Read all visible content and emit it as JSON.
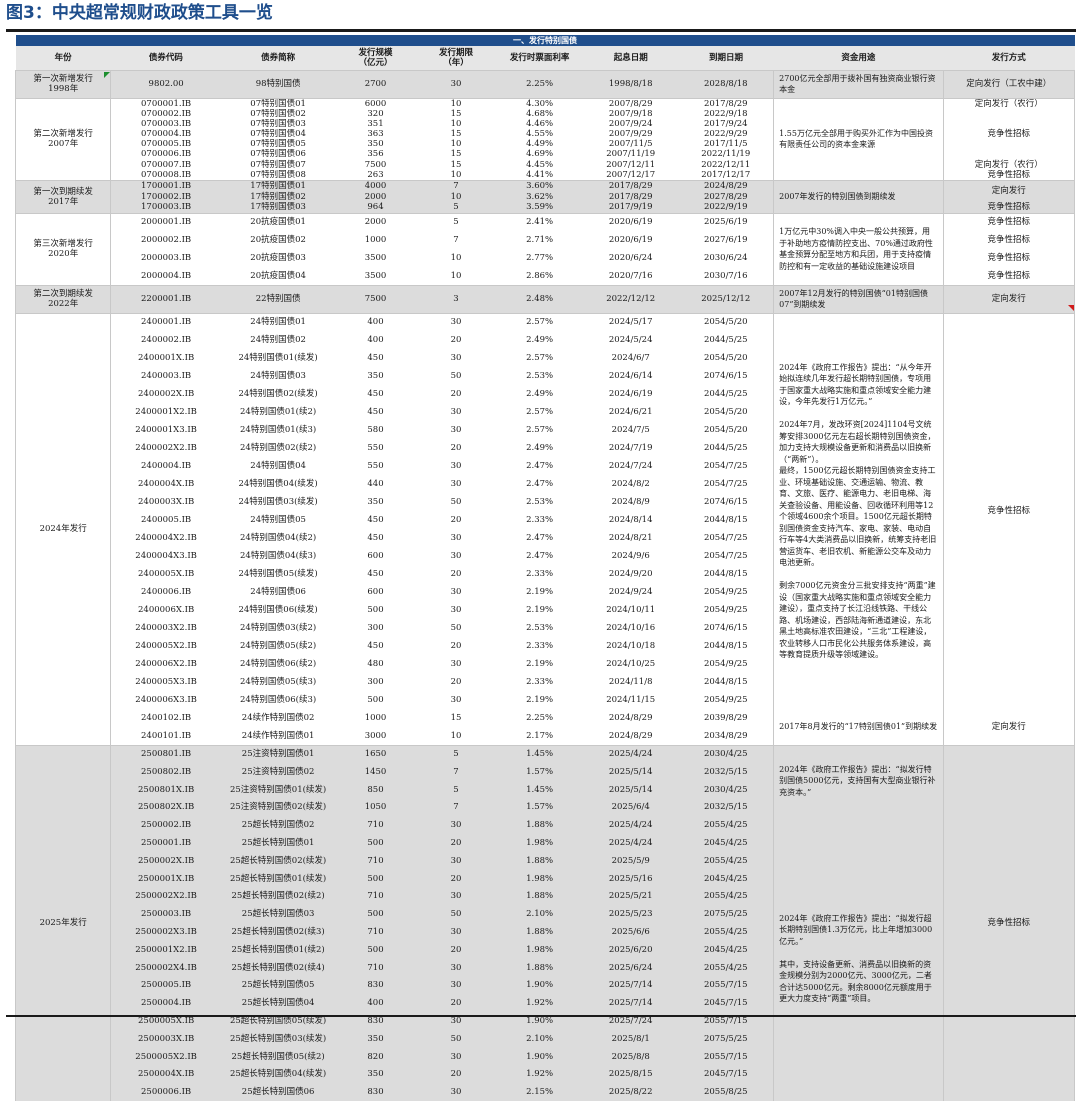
{
  "figure_title": "图3：中央超常规财政政策工具一览",
  "section_title": "一、发行特别国债",
  "headers": {
    "year": "年份",
    "code": "债券代码",
    "name": "债券简称",
    "scale": "发行规模\n（亿元）",
    "term": "发行期限\n（年）",
    "rate": "发行时票面利率",
    "start": "起息日期",
    "due": "到期日期",
    "use": "资金用途",
    "method": "发行方式"
  },
  "groups": [
    {
      "year": "第一次新增发行\n1998年",
      "gray": true,
      "rows": [
        [
          "9802.00",
          "98特别国债",
          "2700",
          "30",
          "2.25%",
          "1998/8/18",
          "2028/8/18"
        ]
      ],
      "uses": [
        {
          "rows": 1,
          "text": "2700亿元全部用于拨补国有独资商业银行资本金"
        }
      ],
      "methods": [
        {
          "rows": 1,
          "text": "定向发行（工农中建）"
        }
      ]
    },
    {
      "year": "第二次新增发行\n2007年",
      "gray": false,
      "rows": [
        [
          "0700001.IB",
          "07特别国债01",
          "6000",
          "10",
          "4.30%",
          "2007/8/29",
          "2017/8/29"
        ],
        [
          "0700002.IB",
          "07特别国债02",
          "320",
          "15",
          "4.68%",
          "2007/9/18",
          "2022/9/18"
        ],
        [
          "0700003.IB",
          "07特别国债03",
          "351",
          "10",
          "4.46%",
          "2007/9/24",
          "2017/9/24"
        ],
        [
          "0700004.IB",
          "07特别国债04",
          "363",
          "15",
          "4.55%",
          "2007/9/29",
          "2022/9/29"
        ],
        [
          "0700005.IB",
          "07特别国债05",
          "350",
          "10",
          "4.49%",
          "2007/11/5",
          "2017/11/5"
        ],
        [
          "0700006.IB",
          "07特别国债06",
          "356",
          "15",
          "4.69%",
          "2007/11/19",
          "2022/11/19"
        ],
        [
          "0700007.IB",
          "07特别国债07",
          "7500",
          "15",
          "4.45%",
          "2007/12/11",
          "2022/12/11"
        ],
        [
          "0700008.IB",
          "07特别国债08",
          "263",
          "10",
          "4.41%",
          "2007/12/17",
          "2017/12/17"
        ]
      ],
      "uses": [
        {
          "rows": 8,
          "text": "1.55万亿元全部用于购买外汇作为中国投资有限责任公司的资本金来源"
        }
      ],
      "methods": [
        {
          "rows": 1,
          "text": "定向发行（农行）"
        },
        {
          "rows": 5,
          "text": "竞争性招标"
        },
        {
          "rows": 1,
          "text": "定向发行（农行）"
        },
        {
          "rows": 1,
          "text": "竞争性招标"
        }
      ]
    },
    {
      "year": "第一次到期续发\n2017年",
      "gray": true,
      "rows": [
        [
          "1700001.IB",
          "17特别国债01",
          "4000",
          "7",
          "3.60%",
          "2017/8/29",
          "2024/8/29"
        ],
        [
          "1700002.IB",
          "17特别国债02",
          "2000",
          "10",
          "3.62%",
          "2017/8/29",
          "2027/8/29"
        ],
        [
          "1700003.IB",
          "17特别国债03",
          "964",
          "5",
          "3.59%",
          "2017/9/19",
          "2022/9/19"
        ]
      ],
      "uses": [
        {
          "rows": 3,
          "text": "2007年发行的特别国债到期续发"
        }
      ],
      "methods": [
        {
          "rows": 2,
          "text": "定向发行"
        },
        {
          "rows": 1,
          "text": "竞争性招标"
        }
      ]
    },
    {
      "year": "第三次新增发行\n2020年",
      "gray": false,
      "rows": [
        [
          "2000001.IB",
          "20抗疫国债01",
          "2000",
          "5",
          "2.41%",
          "2020/6/19",
          "2025/6/19"
        ],
        [
          "2000002.IB",
          "20抗疫国债02",
          "1000",
          "7",
          "2.71%",
          "2020/6/19",
          "2027/6/19"
        ],
        [
          "2000003.IB",
          "20抗疫国债03",
          "3500",
          "10",
          "2.77%",
          "2020/6/24",
          "2030/6/24"
        ],
        [
          "2000004.IB",
          "20抗疫国债04",
          "3500",
          "10",
          "2.86%",
          "2020/7/16",
          "2030/7/16"
        ]
      ],
      "uses": [
        {
          "rows": 4,
          "text": "1万亿元中30%调入中央一般公共预算，用于补助地方疫情防控支出、70%通过政府性基金预算分配至地方和兵团，用于支持疫情防控和有一定收益的基础设施建设项目"
        }
      ],
      "methods": [
        {
          "rows": 1,
          "text": "竞争性招标"
        },
        {
          "rows": 1,
          "text": "竞争性招标"
        },
        {
          "rows": 1,
          "text": "竞争性招标"
        },
        {
          "rows": 1,
          "text": "竞争性招标"
        }
      ]
    },
    {
      "year": "第二次到期续发\n2022年",
      "gray": true,
      "rows": [
        [
          "2200001.IB",
          "22特别国债",
          "7500",
          "3",
          "2.48%",
          "2022/12/12",
          "2025/12/12"
        ]
      ],
      "uses": [
        {
          "rows": 1,
          "text": "2007年12月发行的特别国债“01特别国债07”到期续发"
        }
      ],
      "methods": [
        {
          "rows": 1,
          "text": "定向发行"
        }
      ]
    },
    {
      "year": "2024年发行",
      "gray": false,
      "rows": [
        [
          "2400001.IB",
          "24特别国债01",
          "400",
          "30",
          "2.57%",
          "2024/5/17",
          "2054/5/20"
        ],
        [
          "2400002.IB",
          "24特别国债02",
          "400",
          "20",
          "2.49%",
          "2024/5/24",
          "2044/5/25"
        ],
        [
          "2400001X.IB",
          "24特别国债01(续发)",
          "450",
          "30",
          "2.57%",
          "2024/6/7",
          "2054/5/20"
        ],
        [
          "2400003.IB",
          "24特别国债03",
          "350",
          "50",
          "2.53%",
          "2024/6/14",
          "2074/6/15"
        ],
        [
          "2400002X.IB",
          "24特别国债02(续发)",
          "450",
          "20",
          "2.49%",
          "2024/6/19",
          "2044/5/25"
        ],
        [
          "2400001X2.IB",
          "24特别国债01(续2)",
          "450",
          "30",
          "2.57%",
          "2024/6/21",
          "2054/5/20"
        ],
        [
          "2400001X3.IB",
          "24特别国债01(续3)",
          "580",
          "30",
          "2.57%",
          "2024/7/5",
          "2054/5/20"
        ],
        [
          "2400002X2.IB",
          "24特别国债02(续2)",
          "550",
          "20",
          "2.49%",
          "2024/7/19",
          "2044/5/25"
        ],
        [
          "2400004.IB",
          "24特别国债04",
          "550",
          "30",
          "2.47%",
          "2024/7/24",
          "2054/7/25"
        ],
        [
          "2400004X.IB",
          "24特别国债04(续发)",
          "440",
          "30",
          "2.47%",
          "2024/8/2",
          "2054/7/25"
        ],
        [
          "2400003X.IB",
          "24特别国债03(续发)",
          "350",
          "50",
          "2.53%",
          "2024/8/9",
          "2074/6/15"
        ],
        [
          "2400005.IB",
          "24特别国债05",
          "450",
          "20",
          "2.33%",
          "2024/8/14",
          "2044/8/15"
        ],
        [
          "2400004X2.IB",
          "24特别国债04(续2)",
          "450",
          "30",
          "2.47%",
          "2024/8/21",
          "2054/7/25"
        ],
        [
          "2400004X3.IB",
          "24特别国债04(续3)",
          "600",
          "30",
          "2.47%",
          "2024/9/6",
          "2054/7/25"
        ],
        [
          "2400005X.IB",
          "24特别国债05(续发)",
          "450",
          "20",
          "2.33%",
          "2024/9/20",
          "2044/8/15"
        ],
        [
          "2400006.IB",
          "24特别国债06",
          "600",
          "30",
          "2.19%",
          "2024/9/24",
          "2054/9/25"
        ],
        [
          "2400006X.IB",
          "24特别国债06(续发)",
          "500",
          "30",
          "2.19%",
          "2024/10/11",
          "2054/9/25"
        ],
        [
          "2400003X2.IB",
          "24特别国债03(续2)",
          "300",
          "50",
          "2.53%",
          "2024/10/16",
          "2074/6/15"
        ],
        [
          "2400005X2.IB",
          "24特别国债05(续2)",
          "450",
          "20",
          "2.33%",
          "2024/10/18",
          "2044/8/15"
        ],
        [
          "2400006X2.IB",
          "24特别国债06(续2)",
          "480",
          "30",
          "2.19%",
          "2024/10/25",
          "2054/9/25"
        ],
        [
          "2400005X3.IB",
          "24特别国债05(续3)",
          "300",
          "20",
          "2.33%",
          "2024/11/8",
          "2044/8/15"
        ],
        [
          "2400006X3.IB",
          "24特别国债06(续3)",
          "500",
          "30",
          "2.19%",
          "2024/11/15",
          "2054/9/25"
        ],
        [
          "2400102.IB",
          "24续作特别国债02",
          "1000",
          "15",
          "2.25%",
          "2024/8/29",
          "2039/8/29"
        ],
        [
          "2400101.IB",
          "24续作特别国债01",
          "3000",
          "10",
          "2.17%",
          "2024/8/29",
          "2034/8/29"
        ]
      ],
      "uses": [
        {
          "rows": 22,
          "text": "2024年《政府工作报告》提出：“从今年开始拟连续几年发行超长期特别国债，专项用于国家重大战略实施和重点领域安全能力建设，今年先发行1万亿元。”\n\n2024年7月，发改环资[2024]1104号文统筹安排3000亿元左右超长期特别国债资金，加力支持大规模设备更新和消费品以旧换新（“两新”）。\n最终，1500亿元超长期特别国债资金支持工业、环境基础设施、交通运输、物流、教育、文旅、医疗、能源电力、老旧电梯、海关查验设备、用能设备、回收循环利用等12个领域4600余个项目。1500亿元超长期特别国债资金支持汽车、家电、家装、电动自行车等4大类消费品以旧换新，统筹支持老旧营运货车、老旧农机、新能源公交车及动力电池更新。\n\n剩余7000亿元资金分三批安排支持“两重”建设（国家重大战略实施和重点领域安全能力建设），重点支持了长江沿线铁路、干线公路、机场建设，西部陆海新通道建设，东北黑土地高标准农田建设，“三北”工程建设，农业转移人口市民化公共服务体系建设，高等教育提质升级等领域建设。"
        },
        {
          "rows": 2,
          "text": "2017年8月发行的“17特别国债01”到期续发"
        }
      ],
      "methods": [
        {
          "rows": 22,
          "text": "竞争性招标"
        },
        {
          "rows": 2,
          "text": "定向发行"
        }
      ]
    },
    {
      "year": "2025年发行",
      "gray": true,
      "rows": [
        [
          "2500801.IB",
          "25注资特别国债01",
          "1650",
          "5",
          "1.45%",
          "2025/4/24",
          "2030/4/25"
        ],
        [
          "2500802.IB",
          "25注资特别国债02",
          "1450",
          "7",
          "1.57%",
          "2025/5/14",
          "2032/5/15"
        ],
        [
          "2500801X.IB",
          "25注资特别国债01(续发)",
          "850",
          "5",
          "1.45%",
          "2025/5/14",
          "2030/4/25"
        ],
        [
          "2500802X.IB",
          "25注资特别国债02(续发)",
          "1050",
          "7",
          "1.57%",
          "2025/6/4",
          "2032/5/15"
        ],
        [
          "2500002.IB",
          "25超长特别国债02",
          "710",
          "30",
          "1.88%",
          "2025/4/24",
          "2055/4/25"
        ],
        [
          "2500001.IB",
          "25超长特别国债01",
          "500",
          "20",
          "1.98%",
          "2025/4/24",
          "2045/4/25"
        ],
        [
          "2500002X.IB",
          "25超长特别国债02(续发)",
          "710",
          "30",
          "1.88%",
          "2025/5/9",
          "2055/4/25"
        ],
        [
          "2500001X.IB",
          "25超长特别国债01(续发)",
          "500",
          "20",
          "1.98%",
          "2025/5/16",
          "2045/4/25"
        ],
        [
          "2500002X2.IB",
          "25超长特别国债02(续2)",
          "710",
          "30",
          "1.88%",
          "2025/5/21",
          "2055/4/25"
        ],
        [
          "2500003.IB",
          "25超长特别国债03",
          "500",
          "50",
          "2.10%",
          "2025/5/23",
          "2075/5/25"
        ],
        [
          "2500002X3.IB",
          "25超长特别国债02(续3)",
          "710",
          "30",
          "1.88%",
          "2025/6/6",
          "2055/4/25"
        ],
        [
          "2500001X2.IB",
          "25超长特别国债01(续2)",
          "500",
          "20",
          "1.98%",
          "2025/6/20",
          "2045/4/25"
        ],
        [
          "2500002X4.IB",
          "25超长特别国债02(续4)",
          "710",
          "30",
          "1.88%",
          "2025/6/24",
          "2055/4/25"
        ],
        [
          "2500005.IB",
          "25超长特别国债05",
          "830",
          "30",
          "1.90%",
          "2025/7/14",
          "2055/7/15"
        ],
        [
          "2500004.IB",
          "25超长特别国债04",
          "400",
          "20",
          "1.92%",
          "2025/7/14",
          "2045/7/15"
        ],
        [
          "2500005X.IB",
          "25超长特别国债05(续发)",
          "830",
          "30",
          "1.90%",
          "2025/7/24",
          "2055/7/15"
        ],
        [
          "2500003X.IB",
          "25超长特别国债03(续发)",
          "350",
          "50",
          "2.10%",
          "2025/8/1",
          "2075/5/25"
        ],
        [
          "2500005X2.IB",
          "25超长特别国债05(续2)",
          "820",
          "30",
          "1.90%",
          "2025/8/8",
          "2055/7/15"
        ],
        [
          "2500004X.IB",
          "25超长特别国债04(续发)",
          "350",
          "20",
          "1.92%",
          "2025/8/15",
          "2045/7/15"
        ],
        [
          "2500006.IB",
          "25超长特别国债06",
          "830",
          "30",
          "2.15%",
          "2025/8/22",
          "2055/8/25"
        ]
      ],
      "uses": [
        {
          "rows": 4,
          "text": "2024年《政府工作报告》提出：“拟发行特别国债5000亿元，支持国有大型商业银行补充资本。”"
        },
        {
          "rows": 16,
          "text": "2024年《政府工作报告》提出：“拟发行超长期特别国债1.3万亿元，比上年增加3000亿元。”\n\n其中，支持设备更新、消费品以旧换新的资金规模分别为2000亿元、3000亿元，二者合计达5000亿元。剩余8000亿元额度用于更大力度支持“两重”项目。"
        }
      ],
      "methods": [
        {
          "rows": 20,
          "text": "竞争性招标"
        }
      ]
    }
  ]
}
